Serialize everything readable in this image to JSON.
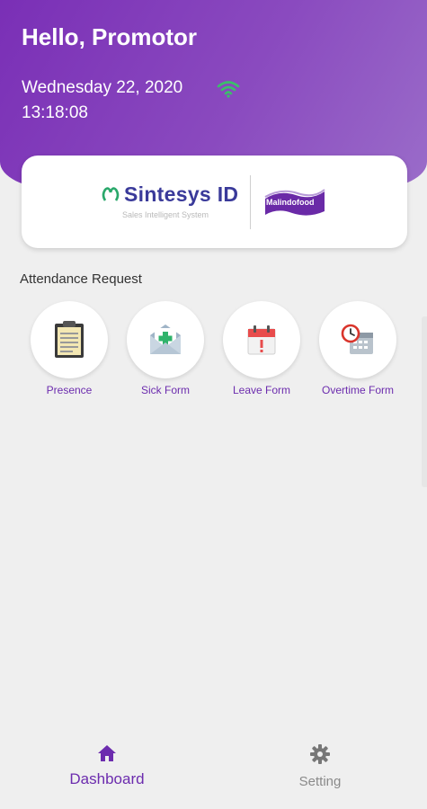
{
  "header": {
    "greeting": "Hello, Promotor",
    "date": "Wednesday 22, 2020",
    "time": "13:18:08",
    "wifi_icon": "wifi-icon",
    "gradient_start": "#7a2fb6",
    "gradient_end": "#9a6cc9"
  },
  "logo_card": {
    "brand_name": "Sintesys ID",
    "brand_tagline": "Sales Intelligent System",
    "partner_logo_text": "Malindofood"
  },
  "attendance": {
    "title": "Attendance Request",
    "items": [
      {
        "label": "Presence",
        "icon": "clipboard-icon"
      },
      {
        "label": "Sick Form",
        "icon": "envelope-plus-icon"
      },
      {
        "label": "Leave Form",
        "icon": "calendar-alert-icon"
      },
      {
        "label": "Overtime Form",
        "icon": "clock-calendar-icon"
      }
    ]
  },
  "bottom_nav": {
    "items": [
      {
        "label": "Dashboard",
        "icon": "home-icon",
        "active": true
      },
      {
        "label": "Setting",
        "icon": "gear-icon",
        "active": false
      }
    ],
    "accent": "#6c2cae"
  }
}
